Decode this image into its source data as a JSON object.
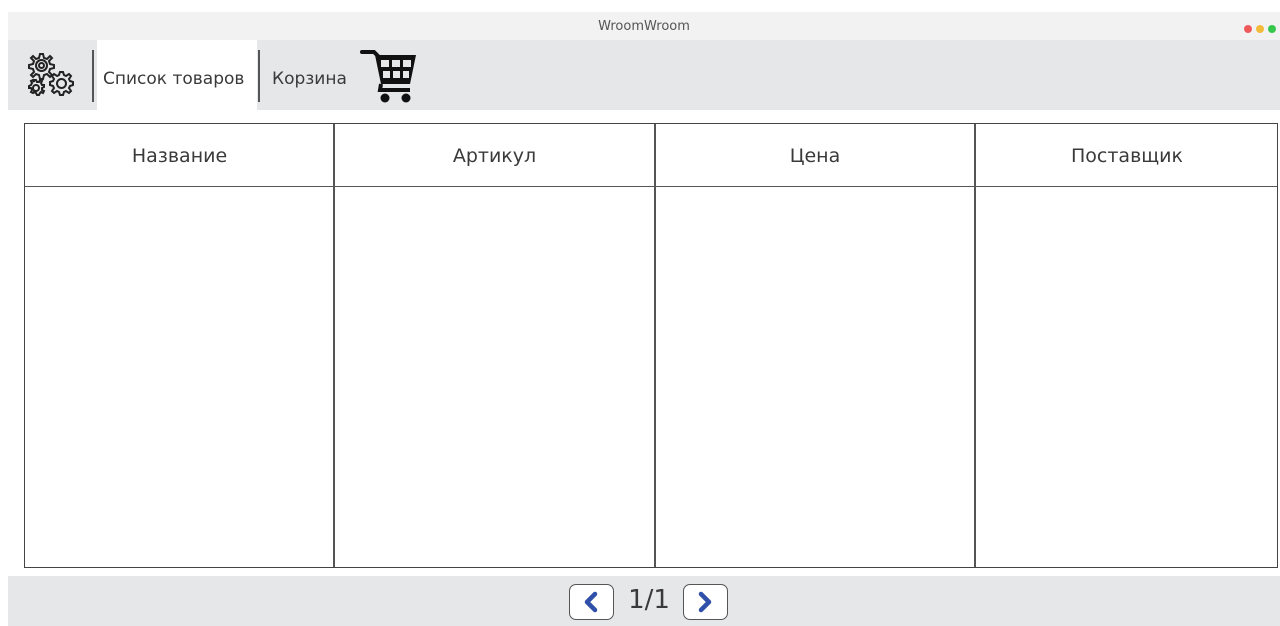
{
  "window": {
    "title": "WroomWroom",
    "controls": [
      "close",
      "minimize",
      "maximize"
    ],
    "control_colors": [
      "#ee5a5a",
      "#f3bb3a",
      "#36c84a"
    ]
  },
  "toolbar": {
    "settings_icon": "gears-icon",
    "tabs": [
      {
        "label": "Список товаров",
        "active": true
      },
      {
        "label": "Корзина",
        "active": false,
        "icon": "shopping-cart-icon"
      }
    ]
  },
  "table": {
    "columns": [
      "Название",
      "Артикул",
      "Цена",
      "Поставщик"
    ],
    "rows": []
  },
  "pagination": {
    "indicator": "1/1",
    "prev_icon": "chevron-left-icon",
    "next_icon": "chevron-right-icon",
    "accent": "#2f4fa8"
  }
}
